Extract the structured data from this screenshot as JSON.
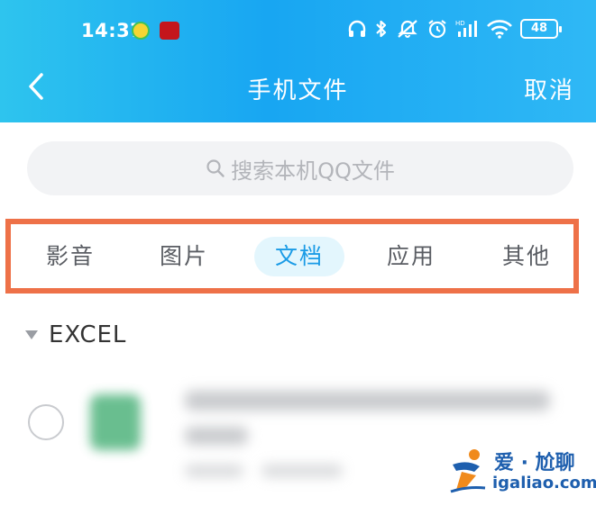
{
  "status_bar": {
    "time": "14:37",
    "app_badge_2": "",
    "battery": "48"
  },
  "nav": {
    "title": "手机文件",
    "cancel": "取消"
  },
  "search": {
    "placeholder": "搜索本机QQ文件"
  },
  "tabs": [
    {
      "label": "影音",
      "active": false
    },
    {
      "label": "图片",
      "active": false
    },
    {
      "label": "文档",
      "active": true
    },
    {
      "label": "应用",
      "active": false
    },
    {
      "label": "其他",
      "active": false
    }
  ],
  "section": {
    "title": "EXCEL"
  },
  "watermark": {
    "top": "爱 · 尬聊",
    "url": "igaliao.com"
  },
  "colors": {
    "header_gradient_start": "#2ec4ee",
    "header_gradient_end": "#18a6f2",
    "active_tab_text": "#1a9be6",
    "active_tab_bg": "#e3f6fd",
    "highlight_border": "#ee7148",
    "file_icon": "#4fb37c"
  }
}
